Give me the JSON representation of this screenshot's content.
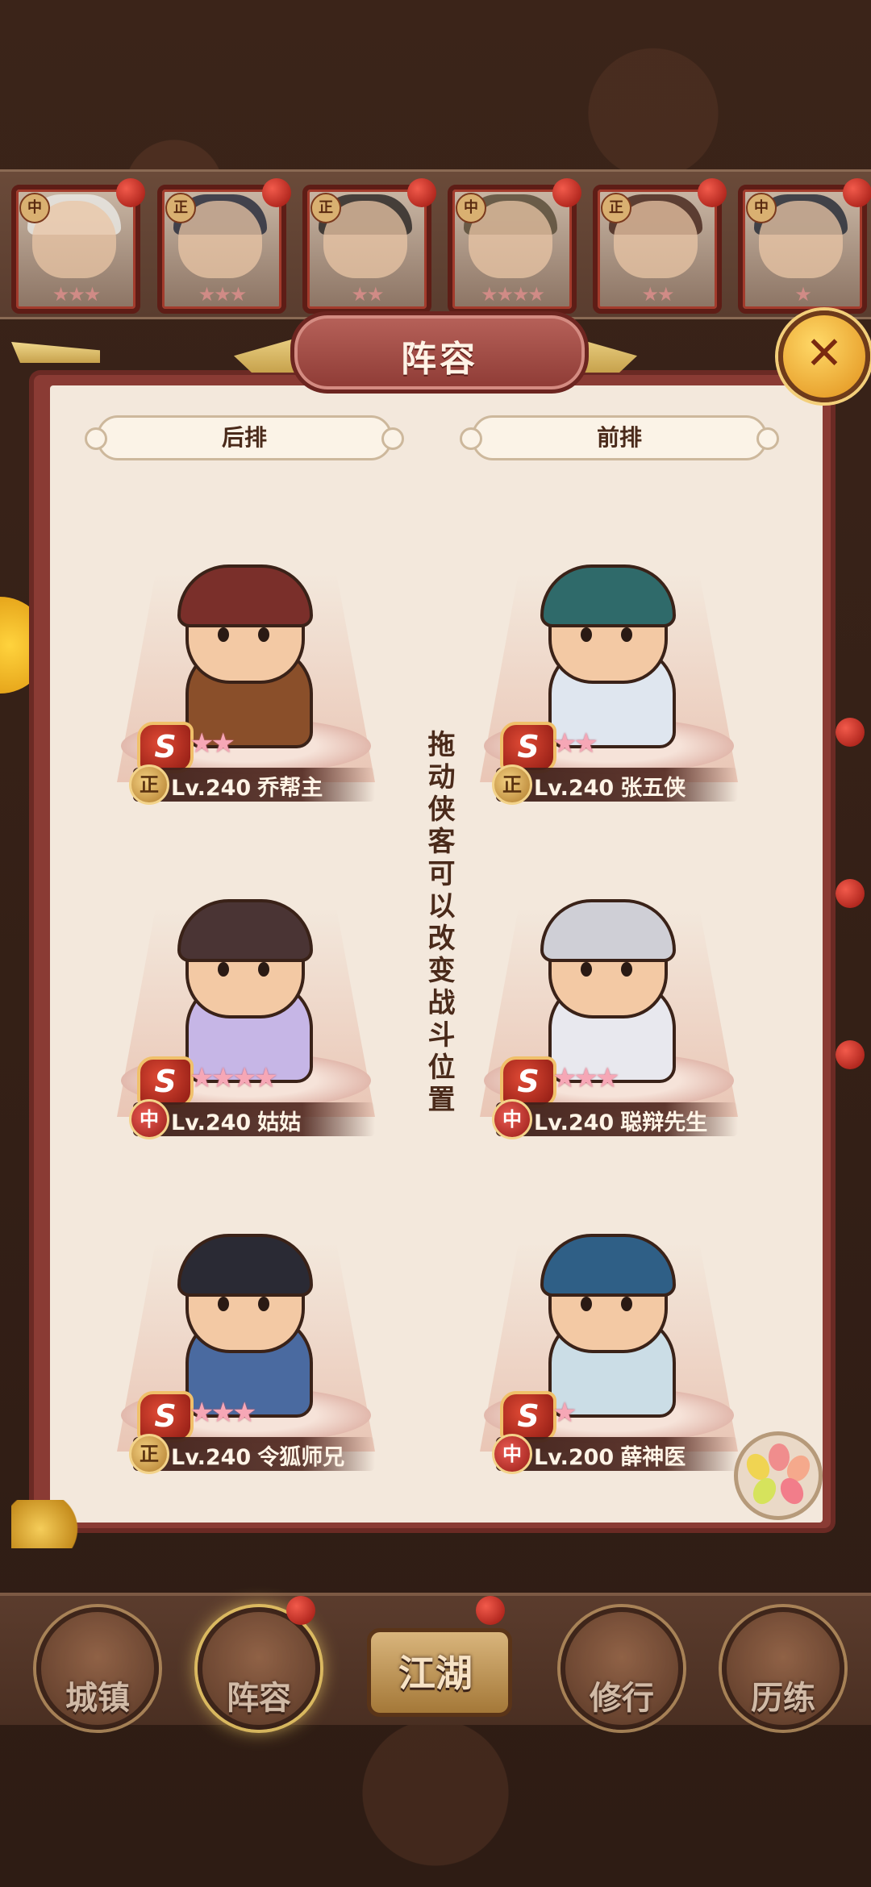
{
  "top_strip": {
    "heroes": [
      {
        "tag": "中",
        "stars": "★★★",
        "hair_color": "#e8e6e2"
      },
      {
        "tag": "正",
        "stars": "★★★",
        "hair_color": "#2b2f3e"
      },
      {
        "tag": "正",
        "stars": "★★",
        "hair_color": "#2f2a28"
      },
      {
        "tag": "中",
        "stars": "★★★★",
        "hair_color": "#5b4d3a"
      },
      {
        "tag": "正",
        "stars": "★★",
        "hair_color": "#4a2a20"
      },
      {
        "tag": "中",
        "stars": "★",
        "hair_color": "#2a2f3a"
      }
    ]
  },
  "dialog": {
    "title": "阵容",
    "close_icon": "✕",
    "back_row_label": "后排",
    "front_row_label": "前排",
    "instruction": "拖动侠客可以改变战斗位置"
  },
  "slots": [
    {
      "id": "back-1",
      "pos_icon": "正",
      "pos_type": "zheng",
      "rank": "S",
      "stars": "★★",
      "level": "Lv.240",
      "name": "乔帮主",
      "hair_color": "#7a2f2a",
      "body_color": "#8a4f2a"
    },
    {
      "id": "front-1",
      "pos_icon": "正",
      "pos_type": "zheng",
      "rank": "S",
      "stars": "★★",
      "level": "Lv.240",
      "name": "张五侠",
      "hair_color": "#2f6a6a",
      "body_color": "#dfe6ef"
    },
    {
      "id": "back-2",
      "pos_icon": "中",
      "pos_type": "zhong",
      "rank": "S",
      "stars": "★★★★",
      "level": "Lv.240",
      "name": "姑姑",
      "hair_color": "#4a3434",
      "body_color": "#c6b6e6"
    },
    {
      "id": "front-2",
      "pos_icon": "中",
      "pos_type": "zhong",
      "rank": "S",
      "stars": "★★★",
      "level": "Lv.240",
      "name": "聪辩先生",
      "hair_color": "#cfcfd6",
      "body_color": "#e8e8ee"
    },
    {
      "id": "back-3",
      "pos_icon": "正",
      "pos_type": "zheng",
      "rank": "S",
      "stars": "★★★",
      "level": "Lv.240",
      "name": "令狐师兄",
      "hair_color": "#2a2a34",
      "body_color": "#4a6aa0"
    },
    {
      "id": "front-3",
      "pos_icon": "中",
      "pos_type": "zhong",
      "rank": "S",
      "stars": "★",
      "level": "Lv.200",
      "name": "薛神医",
      "hair_color": "#2f5f86",
      "body_color": "#cbdde6"
    }
  ],
  "bottom_nav": {
    "items": [
      {
        "label": "城镇"
      },
      {
        "label": "阵容"
      },
      {
        "label": "江湖"
      },
      {
        "label": "修行"
      },
      {
        "label": "历练"
      }
    ]
  },
  "colors": {
    "dialog_frame": "#8a3b34",
    "dialog_paper": "#f3e8dc",
    "accent_gold": "#f0c06a"
  }
}
